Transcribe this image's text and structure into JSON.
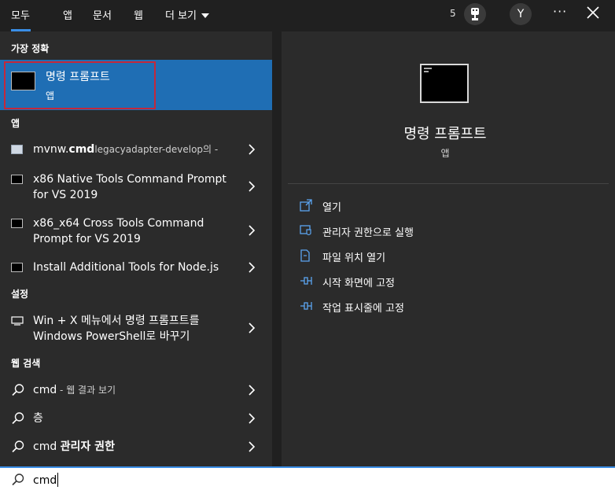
{
  "tabs": [
    {
      "label": "모두"
    },
    {
      "label": "앱"
    },
    {
      "label": "문서"
    },
    {
      "label": "웹"
    },
    {
      "label": "더 보기"
    }
  ],
  "header": {
    "points": "5",
    "avatar_initial": "Y",
    "more_label": "···"
  },
  "best_match": {
    "section_label": "가장 정확",
    "name": "명령 프롬프트",
    "type": "앱"
  },
  "apps": {
    "section_label": "앱",
    "items": [
      {
        "prefix": "mvnw.",
        "bold": "cmd",
        "suffix": "legacyadapter-develop의 -",
        "icon": "script-file-icon"
      },
      {
        "line1": "x86 Native Tools Command Prompt",
        "line2": "for VS 2019",
        "icon": "console-icon"
      },
      {
        "line1": "x86_x64 Cross Tools Command",
        "line2": "Prompt for VS 2019",
        "icon": "console-icon"
      },
      {
        "line1": "Install Additional Tools for Node.js",
        "icon": "console-icon"
      }
    ]
  },
  "settings": {
    "section_label": "설정",
    "items": [
      {
        "line1": "Win + X 메뉴에서 명령 프롬프트를",
        "line2": "Windows PowerShell로 바꾸기",
        "icon": "display-icon"
      }
    ]
  },
  "web_search": {
    "section_label": "웹 검색",
    "items": [
      {
        "query": "cmd",
        "hint": " - 웹 결과 보기"
      },
      {
        "query": "층"
      },
      {
        "query_plain": "cmd ",
        "query_bold": "관리자 권한"
      }
    ]
  },
  "preview": {
    "name": "명령 프롬프트",
    "type": "앱",
    "actions": [
      {
        "label": "열기",
        "icon": "open-icon"
      },
      {
        "label": "관리자 권한으로 실행",
        "icon": "shield-icon"
      },
      {
        "label": "파일 위치 열기",
        "icon": "folder-icon"
      },
      {
        "label": "시작 화면에 고정",
        "icon": "pin-icon"
      },
      {
        "label": "작업 표시줄에 고정",
        "icon": "pin-icon"
      }
    ]
  },
  "search": {
    "value": "cmd"
  },
  "colors": {
    "accent": "#3a8ee6",
    "selection": "#1f6eb4",
    "focus_border": "#c4283b",
    "panel": "#2b2b2b",
    "background": "#202020"
  }
}
